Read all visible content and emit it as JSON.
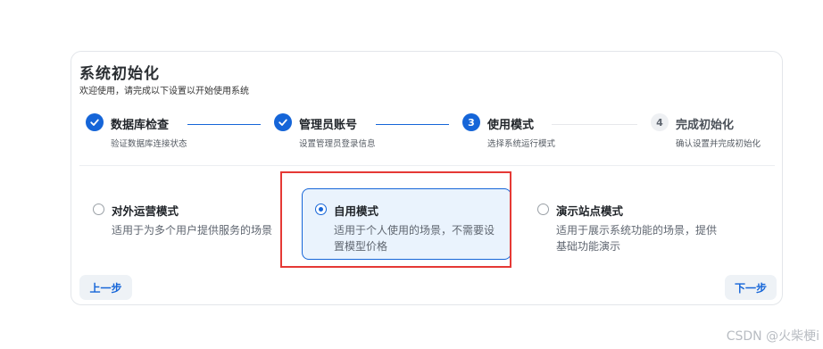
{
  "header": {
    "title": "系统初始化",
    "subtitle": "欢迎使用，请完成以下设置以开始使用系统"
  },
  "steps": [
    {
      "number": "",
      "label": "数据库检查",
      "desc": "验证数据库连接状态",
      "status": "done"
    },
    {
      "number": "",
      "label": "管理员账号",
      "desc": "设置管理员登录信息",
      "status": "done"
    },
    {
      "number": "3",
      "label": "使用模式",
      "desc": "选择系统运行模式",
      "status": "current"
    },
    {
      "number": "4",
      "label": "完成初始化",
      "desc": "确认设置并完成初始化",
      "status": "pending"
    }
  ],
  "options": [
    {
      "title": "对外运营模式",
      "desc": "适用于为多个用户提供服务的场景",
      "selected": false
    },
    {
      "title": "自用模式",
      "desc": "适用于个人使用的场景，不需要设置模型价格",
      "selected": true
    },
    {
      "title": "演示站点模式",
      "desc": "适用于展示系统功能的场景，提供基础功能演示",
      "selected": false
    }
  ],
  "buttons": {
    "prev": "上一步",
    "next": "下一步"
  },
  "watermark": "CSDN @火柴梗i",
  "colors": {
    "accent": "#1565d8",
    "highlight_border": "#e53935",
    "selected_bg": "#eaf3fd"
  }
}
